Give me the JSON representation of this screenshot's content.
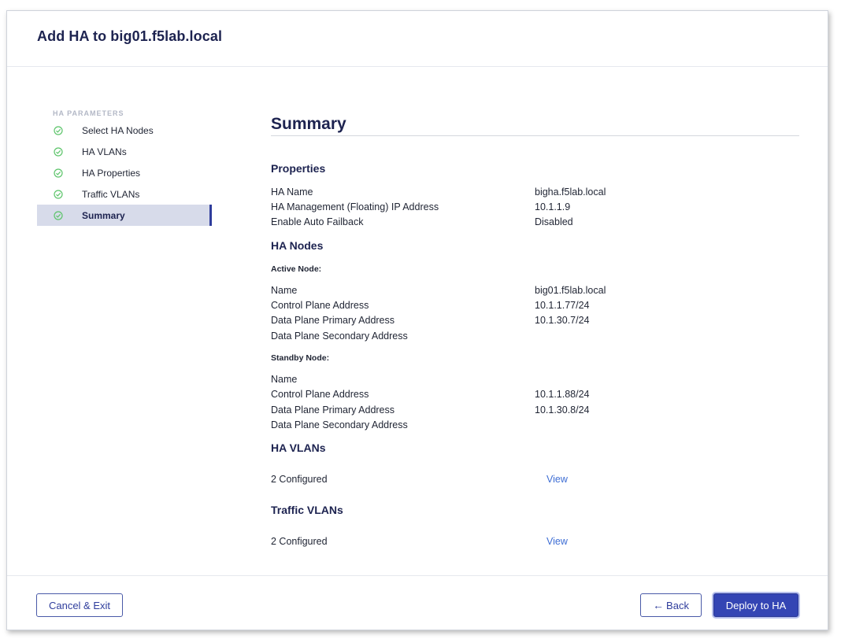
{
  "dialog": {
    "title": "Add HA to big01.f5lab.local"
  },
  "sidebar": {
    "heading": "HA PARAMETERS",
    "steps": [
      {
        "label": "Select HA Nodes"
      },
      {
        "label": "HA VLANs"
      },
      {
        "label": "HA Properties"
      },
      {
        "label": "Traffic VLANs"
      },
      {
        "label": "Summary"
      }
    ],
    "active_step": "Summary",
    "check_color": "#5cc46a"
  },
  "main": {
    "title": "Summary",
    "properties": {
      "title": "Properties",
      "rows": [
        {
          "label": "HA Name",
          "value": "bigha.f5lab.local"
        },
        {
          "label": "HA Management (Floating) IP Address",
          "value": "10.1.1.9"
        },
        {
          "label": "Enable Auto Failback",
          "value": "Disabled"
        }
      ]
    },
    "ha_nodes": {
      "title": "HA Nodes",
      "active": {
        "title": "Active Node:",
        "rows": [
          {
            "label": "Name",
            "value": "big01.f5lab.local"
          },
          {
            "label": "Control Plane Address",
            "value": "10.1.1.77/24"
          },
          {
            "label": "Data Plane Primary Address",
            "value": "10.1.30.7/24"
          },
          {
            "label": "Data Plane Secondary Address",
            "value": ""
          }
        ]
      },
      "standby": {
        "title": "Standby Node:",
        "rows": [
          {
            "label": "Name",
            "value": ""
          },
          {
            "label": "Control Plane Address",
            "value": "10.1.1.88/24"
          },
          {
            "label": "Data Plane Primary Address",
            "value": "10.1.30.8/24"
          },
          {
            "label": "Data Plane Secondary Address",
            "value": ""
          }
        ]
      }
    },
    "ha_vlans": {
      "title": "HA VLANs",
      "count": "2 Configured",
      "link": "View"
    },
    "traffic_vlans": {
      "title": "Traffic VLANs",
      "count": "2 Configured",
      "link": "View"
    }
  },
  "footer": {
    "cancel_label": "Cancel & Exit",
    "back_label": "Back",
    "deploy_label": "Deploy to HA"
  },
  "colors": {
    "title": "#1d2350",
    "primary_button": "#3445b4",
    "link": "#3d6dd4",
    "active_step_bg": "#d7dbea"
  }
}
